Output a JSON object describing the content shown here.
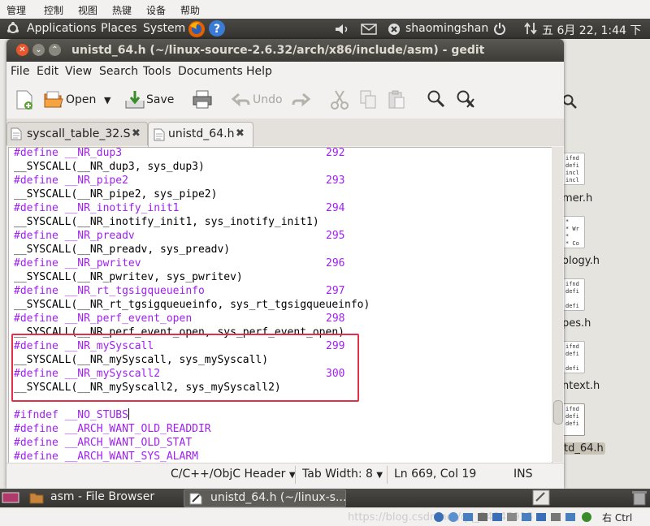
{
  "host_menu": [
    "管理",
    "控制",
    "视图",
    "热键",
    "设备",
    "帮助"
  ],
  "top_panel": {
    "applications": "Applications",
    "places": "Places",
    "system": "System",
    "user": "shaomingshan",
    "datetime": "五 6月 22, 1:44 下"
  },
  "window": {
    "title": "unistd_64.h (~/linux-source-2.6.32/arch/x86/include/asm) - gedit"
  },
  "menubar": [
    "File",
    "Edit",
    "View",
    "Search",
    "Tools",
    "Documents",
    "Help"
  ],
  "toolbar": {
    "open_label": "Open",
    "save_label": "Save",
    "undo_label": "Undo"
  },
  "tabs": [
    {
      "label": "syscall_table_32.S"
    },
    {
      "label": "unistd_64.h"
    }
  ],
  "code_lines": [
    {
      "define": "#define",
      "name": "__NR_dup3",
      "num": "292"
    },
    {
      "call": "__SYSCALL(__NR_dup3, sys_dup3)"
    },
    {
      "define": "#define",
      "name": "__NR_pipe2",
      "num": "293"
    },
    {
      "call": "__SYSCALL(__NR_pipe2, sys_pipe2)"
    },
    {
      "define": "#define",
      "name": "__NR_inotify_init1",
      "num": "294"
    },
    {
      "call": "__SYSCALL(__NR_inotify_init1, sys_inotify_init1)"
    },
    {
      "define": "#define",
      "name": "__NR_preadv",
      "num": "295"
    },
    {
      "call": "__SYSCALL(__NR_preadv, sys_preadv)"
    },
    {
      "define": "#define",
      "name": "__NR_pwritev",
      "num": "296"
    },
    {
      "call": "__SYSCALL(__NR_pwritev, sys_pwritev)"
    },
    {
      "define": "#define",
      "name": "__NR_rt_tgsigqueueinfo",
      "num": "297"
    },
    {
      "call": "__SYSCALL(__NR_rt_tgsigqueueinfo, sys_rt_tgsigqueueinfo)"
    },
    {
      "define": "#define",
      "name": "__NR_perf_event_open",
      "num": "298"
    },
    {
      "call": "__SYSCALL(__NR_perf_event_open, sys_perf_event_open)"
    },
    {
      "define": "#define",
      "name": "__NR_mySyscall",
      "num": "299"
    },
    {
      "call": "__SYSCALL(__NR_mySyscall, sys_mySyscall)"
    },
    {
      "define": "#define",
      "name": "__NR_mySyscall2",
      "num": "300"
    },
    {
      "call": "__SYSCALL(__NR_mySyscall2, sys_mySyscall2)"
    },
    {
      "call": ""
    },
    {
      "define": "#ifndef",
      "name": "__NO_STUBS",
      "num": ""
    },
    {
      "define": "#define",
      "name": "__ARCH_WANT_OLD_READDIR",
      "num": ""
    },
    {
      "define": "#define",
      "name": "__ARCH_WANT_OLD_STAT",
      "num": ""
    },
    {
      "define": "#define",
      "name": "__ARCH_WANT_SYS_ALARM",
      "num": ""
    }
  ],
  "statusbar": {
    "language": "C/C++/ObjC Header",
    "tab_width": "Tab Width: 8",
    "position": "Ln 669, Col 19",
    "mode": "INS"
  },
  "file_browser": {
    "files": [
      {
        "name": "mer.h",
        "preview": "ifnd\ndefi\nincl\nincl"
      },
      {
        "name": "ology.h",
        "preview": "*\n* Wr\n*\n* Co"
      },
      {
        "name": "pes.h",
        "preview": "ifnd\ndefi\n\ndefi"
      },
      {
        "name": "ntext.h",
        "preview": "ifnd\ndefi\n\ndefi"
      },
      {
        "name": "td_64.h",
        "preview": "ifnd\ndefi\ndefi"
      }
    ]
  },
  "taskbar": [
    {
      "label": "asm - File Browser"
    },
    {
      "label": "unistd_64.h (~/linux-s..."
    }
  ],
  "host_status": {
    "watermark": "https://blog.csdn.net/qq_34845915",
    "key": "右 Ctrl"
  }
}
